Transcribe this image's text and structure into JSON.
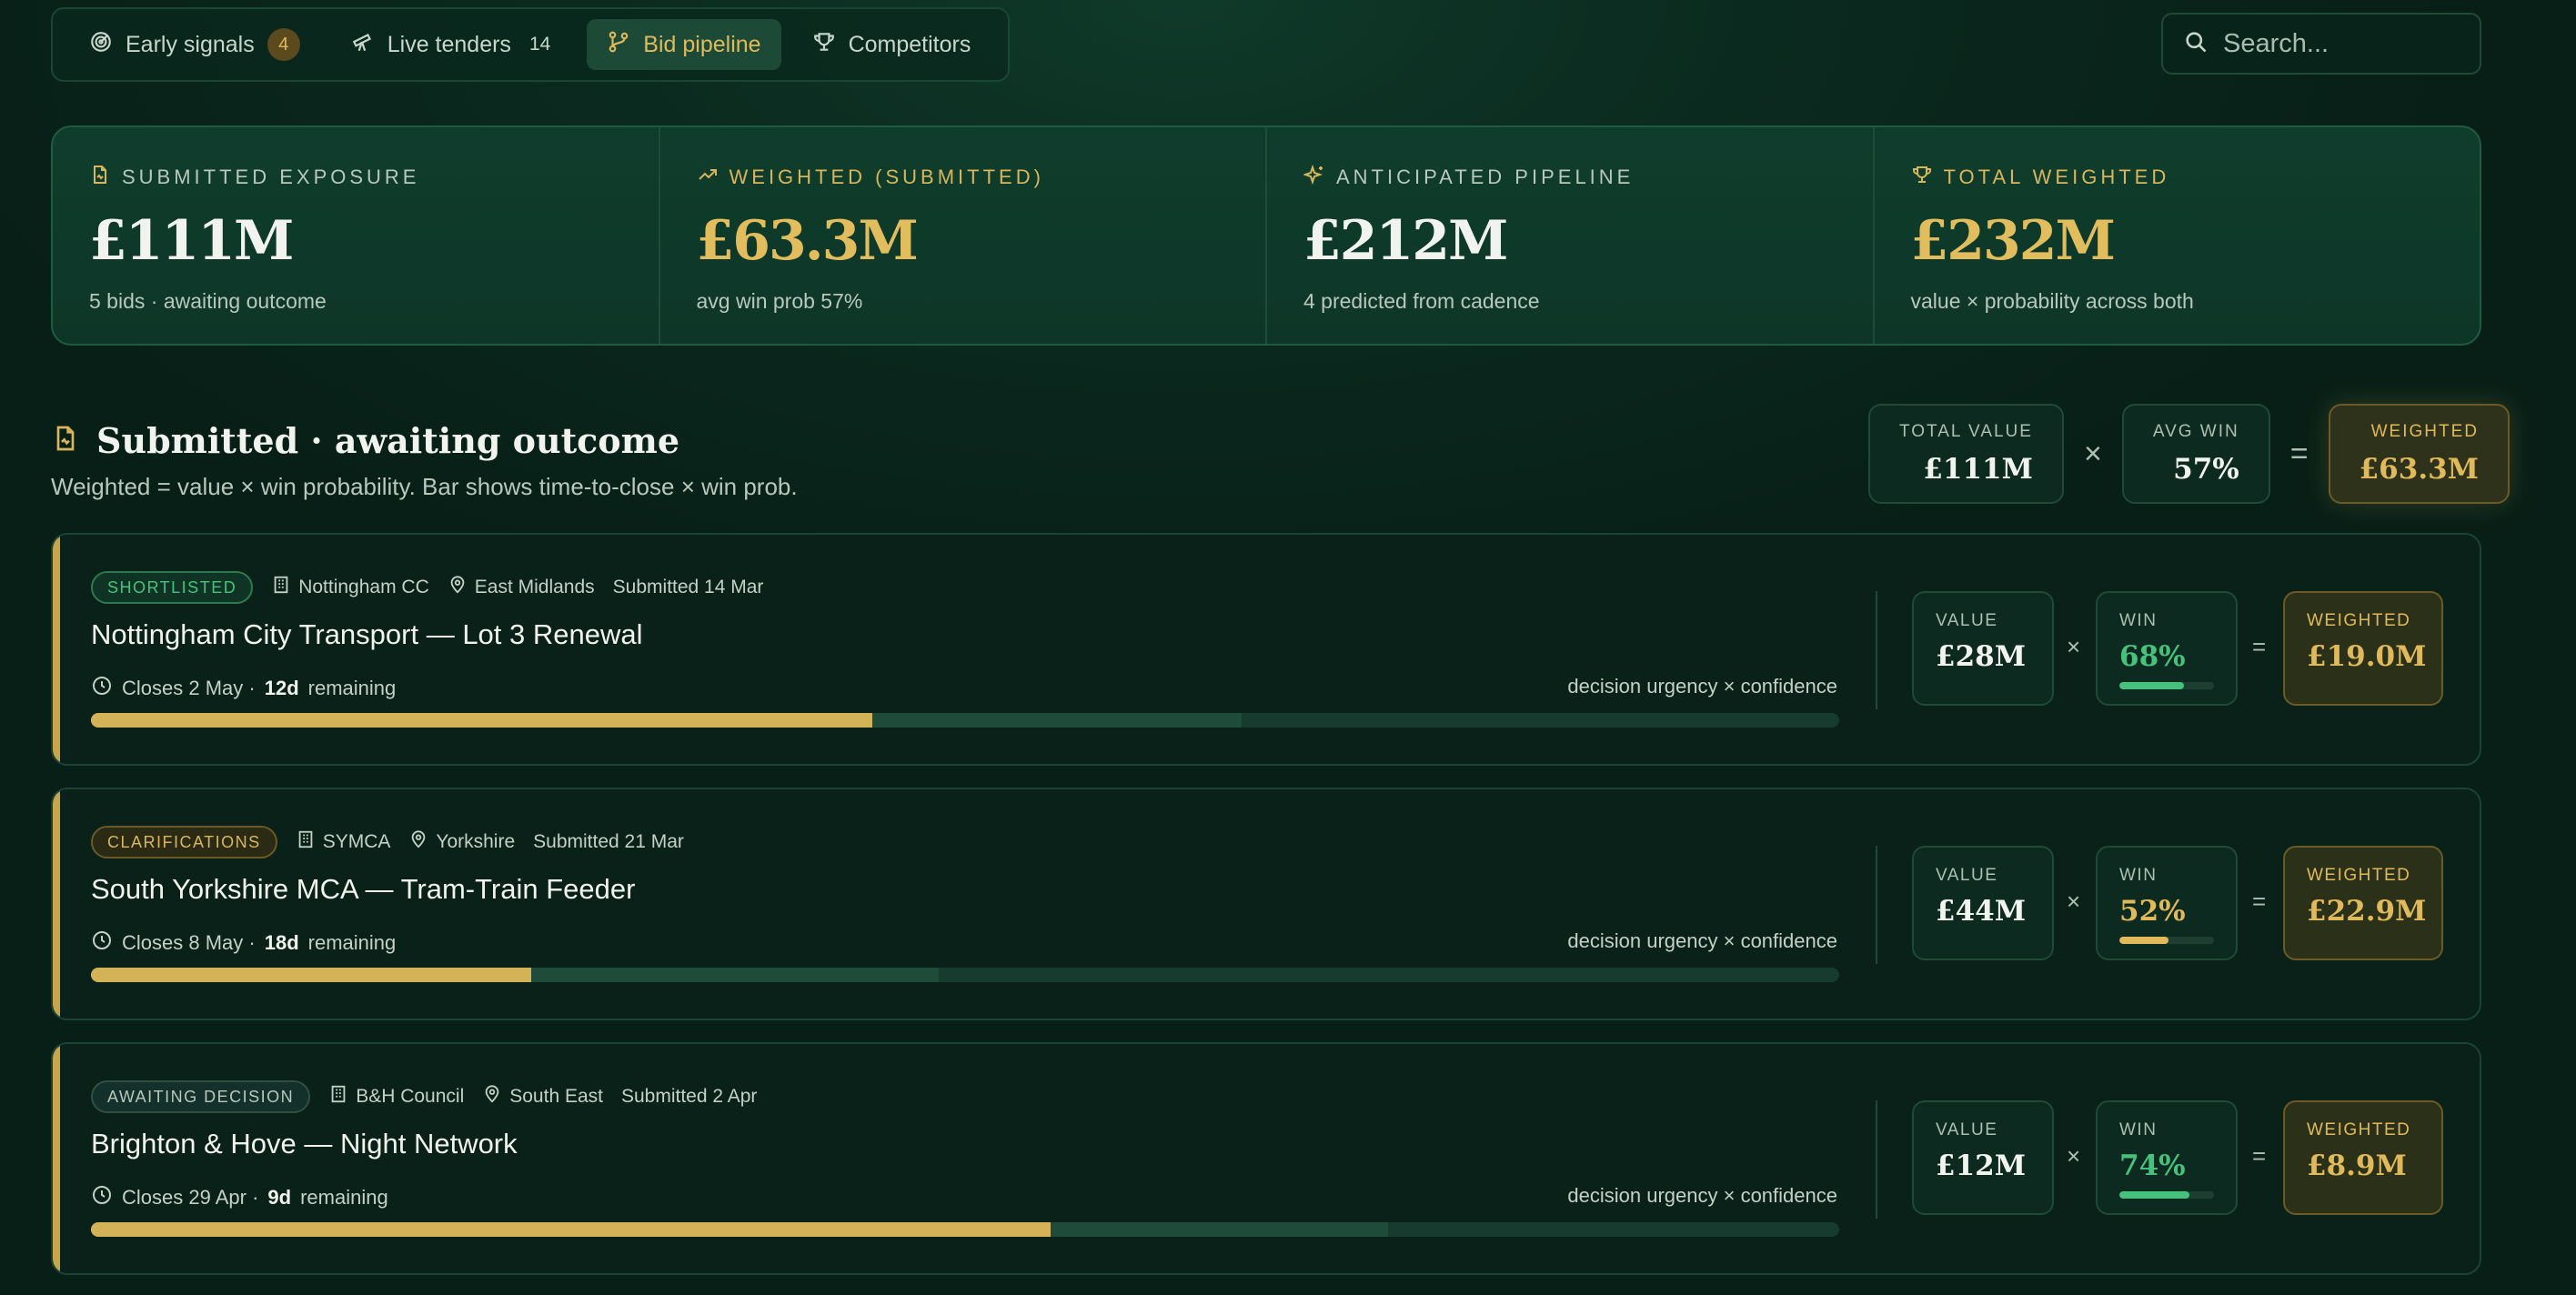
{
  "nav": {
    "tabs": [
      {
        "label": "Early signals",
        "count": "4",
        "icon": "radar-icon"
      },
      {
        "label": "Live tenders",
        "count": "14",
        "icon": "telescope-icon"
      },
      {
        "label": "Bid pipeline",
        "active": true,
        "icon": "branch-icon"
      },
      {
        "label": "Competitors",
        "icon": "trophy-icon"
      }
    ]
  },
  "search": {
    "placeholder": "Search..."
  },
  "stats": [
    {
      "label": "SUBMITTED EXPOSURE",
      "value": "£111M",
      "sub": "5 bids · awaiting outcome"
    },
    {
      "label": "WEIGHTED (SUBMITTED)",
      "value": "£63.3M",
      "sub": "avg win prob 57%"
    },
    {
      "label": "ANTICIPATED PIPELINE",
      "value": "£212M",
      "sub": "4 predicted from cadence"
    },
    {
      "label": "TOTAL WEIGHTED",
      "value": "£232M",
      "sub": "value × probability across both"
    }
  ],
  "section": {
    "title": "Submitted · awaiting outcome",
    "subtitle": "Weighted = value × win probability. Bar shows time-to-close × win prob.",
    "formula": {
      "total_label": "TOTAL VALUE",
      "total_value": "£111M",
      "times": "×",
      "avg_label": "AVG WIN",
      "avg_value": "57%",
      "equals": "=",
      "weighted_label": "WEIGHTED",
      "weighted_value": "£63.3M"
    }
  },
  "bids": [
    {
      "status": "SHORTLISTED",
      "buyer": "Nottingham CC",
      "region": "East Midlands",
      "submitted": "Submitted 14 Mar",
      "title": "Nottingham City Transport — Lot 3 Renewal",
      "closes": "Closes 2 May ·",
      "days": "12d",
      "remaining": "remaining",
      "urgency_label": "decision urgency × confidence",
      "bar_fill": 0.447,
      "bar_ghost": 0.658,
      "value_label": "VALUE",
      "value": "£28M",
      "win_label": "WIN",
      "win": "68%",
      "win_frac": 0.68,
      "weighted_label": "WEIGHTED",
      "weighted": "£19.0M",
      "times": "×",
      "equals": "="
    },
    {
      "status": "CLARIFICATIONS",
      "buyer": "SYMCA",
      "region": "Yorkshire",
      "submitted": "Submitted 21 Mar",
      "title": "South Yorkshire MCA — Tram-Train Feeder",
      "closes": "Closes 8 May ·",
      "days": "18d",
      "remaining": "remaining",
      "urgency_label": "decision urgency × confidence",
      "bar_fill": 0.252,
      "bar_ghost": 0.485,
      "value_label": "VALUE",
      "value": "£44M",
      "win_label": "WIN",
      "win": "52%",
      "win_frac": 0.52,
      "weighted_label": "WEIGHTED",
      "weighted": "£22.9M",
      "times": "×",
      "equals": "="
    },
    {
      "status": "AWAITING DECISION",
      "buyer": "B&H Council",
      "region": "South East",
      "submitted": "Submitted 2 Apr",
      "title": "Brighton & Hove — Night Network",
      "closes": "Closes 29 Apr ·",
      "days": "9d",
      "remaining": "remaining",
      "urgency_label": "decision urgency × confidence",
      "bar_fill": 0.549,
      "bar_ghost": 0.742,
      "value_label": "VALUE",
      "value": "£12M",
      "win_label": "WIN",
      "win": "74%",
      "win_frac": 0.74,
      "weighted_label": "WEIGHTED",
      "weighted": "£8.9M",
      "times": "×",
      "equals": "="
    }
  ],
  "colors": {
    "gold": "#e0b95a",
    "green": "#46c27d",
    "background": "#0b2a1f"
  }
}
